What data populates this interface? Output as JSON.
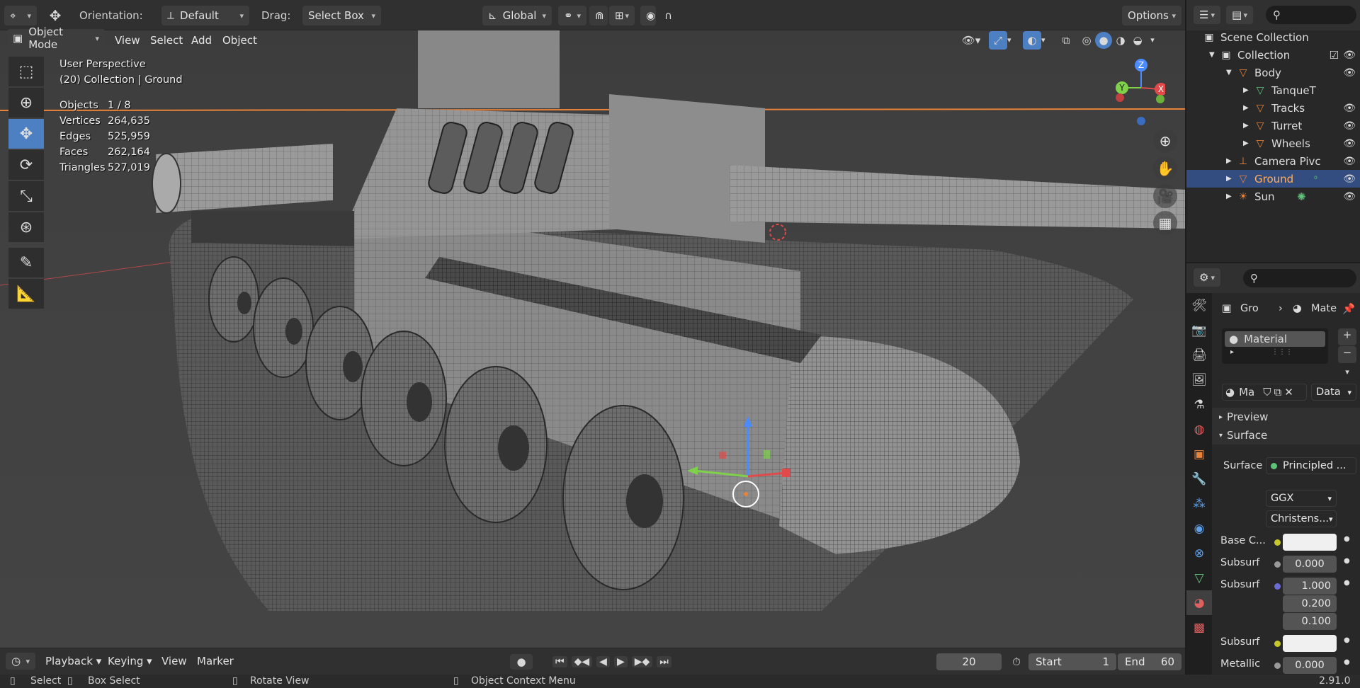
{
  "header": {
    "orientation_label": "Orientation:",
    "orientation_value": "Default",
    "drag_label": "Drag:",
    "drag_value": "Select Box",
    "transform_space": "Global",
    "options_label": "Options"
  },
  "menu": {
    "mode": "Object Mode",
    "items": [
      "View",
      "Select",
      "Add",
      "Object"
    ]
  },
  "viewport": {
    "perspective": "User Perspective",
    "context": "(20) Collection | Ground",
    "stats": [
      {
        "key": "Objects",
        "value": "1 / 8"
      },
      {
        "key": "Vertices",
        "value": "264,635"
      },
      {
        "key": "Edges",
        "value": "525,959"
      },
      {
        "key": "Faces",
        "value": "262,164"
      },
      {
        "key": "Triangles",
        "value": "527,019"
      }
    ],
    "gizmo": {
      "z": "Z",
      "x": "X",
      "y": "Y"
    }
  },
  "outliner": {
    "scene_collection": "Scene Collection",
    "items": [
      {
        "label": "Collection",
        "icon": "collection-icon"
      },
      {
        "label": "Body",
        "icon": "mesh-icon"
      },
      {
        "label": "TanqueT",
        "icon": "mesh-data-icon"
      },
      {
        "label": "Tracks",
        "icon": "mesh-icon"
      },
      {
        "label": "Turret",
        "icon": "mesh-icon"
      },
      {
        "label": "Wheels",
        "icon": "mesh-icon"
      },
      {
        "label": "Camera Pivc",
        "icon": "empty-icon"
      },
      {
        "label": "Ground",
        "icon": "mesh-icon"
      },
      {
        "label": "Sun",
        "icon": "light-icon"
      }
    ]
  },
  "properties": {
    "object_name": "Gro",
    "material_tab": "Mate",
    "slot_name": "Material",
    "material_field": "Ma",
    "data_dropdown": "Data",
    "preview_label": "Preview",
    "surface_panel": "Surface",
    "surface_label": "Surface",
    "surface_value": "Principled ...",
    "distribution": "GGX",
    "subsurface_method": "Christens...",
    "rows": [
      {
        "label": "Base C...",
        "value": ""
      },
      {
        "label": "Subsurf",
        "value": "0.000"
      },
      {
        "label": "Subsurf",
        "value": "1.000"
      },
      {
        "label": "",
        "value": "0.200"
      },
      {
        "label": "",
        "value": "0.100"
      },
      {
        "label": "Subsurf",
        "value": ""
      },
      {
        "label": "Metallic",
        "value": "0.000"
      }
    ]
  },
  "timeline": {
    "items": [
      "Playback",
      "Keying",
      "View",
      "Marker"
    ],
    "current_frame": "20",
    "start_label": "Start",
    "start_value": "1",
    "end_label": "End",
    "end_value": "60"
  },
  "statusbar": {
    "select": "Select",
    "box_select": "Box Select",
    "rotate_view": "Rotate View",
    "context_menu": "Object Context Menu",
    "version": "2.91.0"
  },
  "colors": {
    "accent": "#4d7fc3",
    "selected_row": "#334d80",
    "orange": "#e8833a"
  }
}
